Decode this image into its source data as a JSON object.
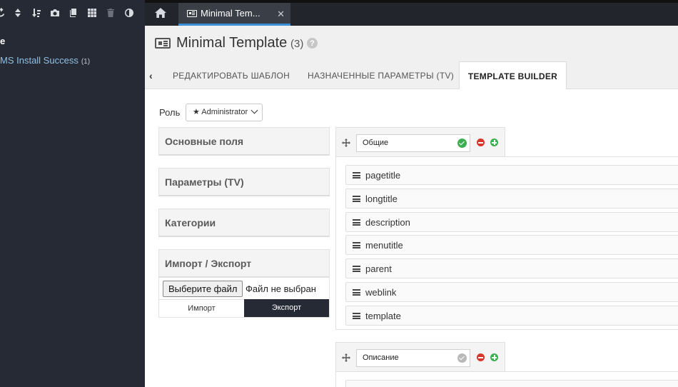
{
  "sidebar": {
    "tree": {
      "root_label": "e",
      "child_label": "MS Install Success",
      "child_count": "(1)"
    }
  },
  "topbar": {
    "tab_label": "Minimal Tem...",
    "close_glyph": "✕"
  },
  "header": {
    "title": "Minimal Template",
    "count": "(3)",
    "help_glyph": "?"
  },
  "tabs": [
    {
      "label": "РЕДАКТИРОВАТЬ ШАБЛОН"
    },
    {
      "label": "НАЗНАЧЕННЫЕ ПАРАМЕТРЫ (TV)"
    },
    {
      "label": "TEMPLATE BUILDER"
    }
  ],
  "back_glyph": "‹",
  "role": {
    "label": "Роль",
    "value": "★ Administrator"
  },
  "panels": [
    {
      "title": "Основные поля"
    },
    {
      "title": "Параметры (TV)"
    },
    {
      "title": "Категории"
    },
    {
      "title": "Импорт / Экспорт"
    }
  ],
  "import_export": {
    "file_button": "Выберите файл",
    "file_status": "Файл не выбран",
    "import_label": "Импорт",
    "export_label": "Экспорт"
  },
  "groups": [
    {
      "name": "Общие",
      "fields": [
        "pagetitle",
        "longtitle",
        "description",
        "menutitle",
        "parent",
        "weblink",
        "template"
      ]
    },
    {
      "name": "Описание",
      "fields": []
    }
  ],
  "colors": {
    "sidebar_bg": "#262a34",
    "accent": "#3d8fd5",
    "ok": "#3cae52",
    "remove": "#d9352c"
  },
  "icons": [
    "refresh-icon",
    "sort-icon",
    "sort-down-icon",
    "camera-icon",
    "copy-icon",
    "grid-icon",
    "trash-icon",
    "contrast-icon",
    "home-icon",
    "template-icon",
    "move-icon",
    "drag-handle-icon",
    "check-icon",
    "remove-icon",
    "add-icon",
    "help-icon",
    "chevron-left-icon",
    "chevron-down-icon"
  ]
}
